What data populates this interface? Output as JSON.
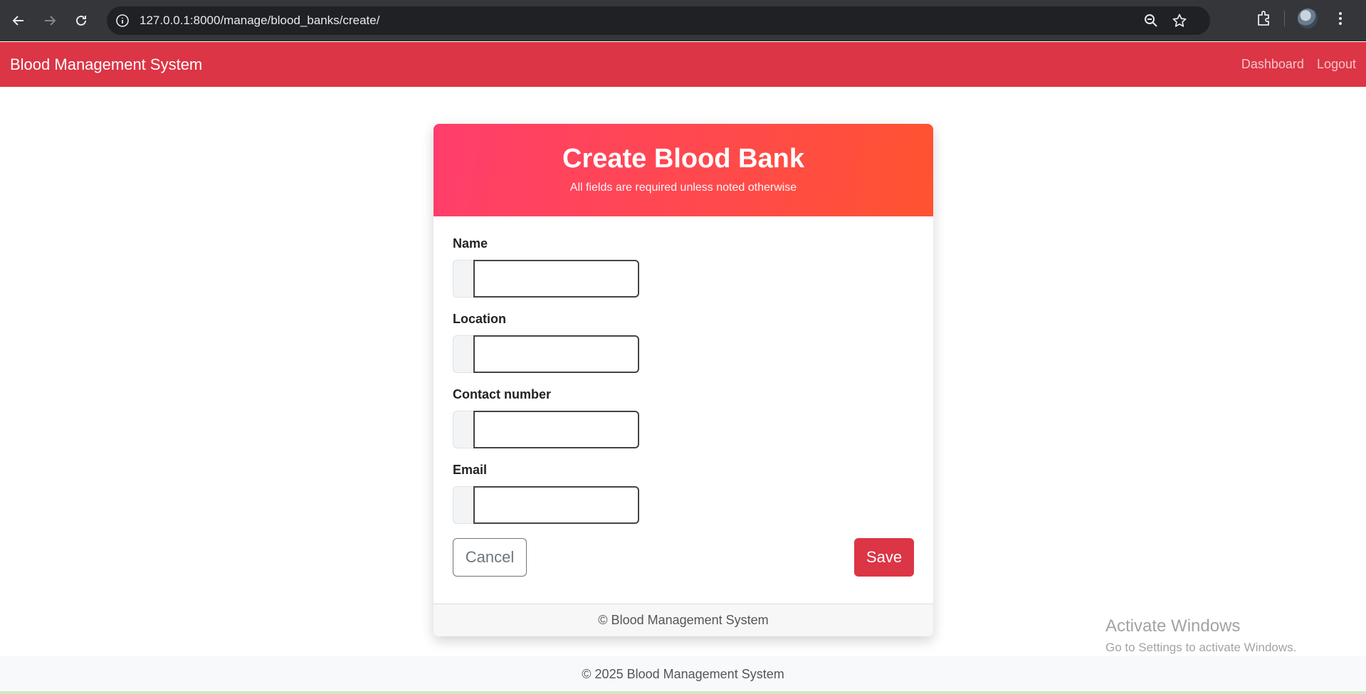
{
  "browser": {
    "url": "127.0.0.1:8000/manage/blood_banks/create/",
    "icons": [
      "back-arrow-icon",
      "forward-arrow-icon",
      "reload-icon",
      "site-info-icon",
      "zoom-icon",
      "bookmark-star-icon",
      "extensions-icon",
      "profile-avatar-icon",
      "more-menu-icon"
    ]
  },
  "navbar": {
    "brand": "Blood Management System",
    "links": [
      "Dashboard",
      "Logout"
    ]
  },
  "card": {
    "title": "Create Blood Bank",
    "subtitle": "All fields are required unless noted otherwise",
    "fields": [
      {
        "label": "Name",
        "value": ""
      },
      {
        "label": "Location",
        "value": ""
      },
      {
        "label": "Contact number",
        "value": ""
      },
      {
        "label": "Email",
        "value": ""
      }
    ],
    "cancel_label": "Cancel",
    "save_label": "Save",
    "footer": "© Blood Management System"
  },
  "page_footer": "© 2025 Blood Management System",
  "watermark": {
    "title": "Activate Windows",
    "subtitle": "Go to Settings to activate Windows."
  },
  "colors": {
    "navbar": "#dc3545",
    "header_gradient_start": "#ff3e6c",
    "header_gradient_end": "#ff5330",
    "save_button": "#dc3545"
  }
}
